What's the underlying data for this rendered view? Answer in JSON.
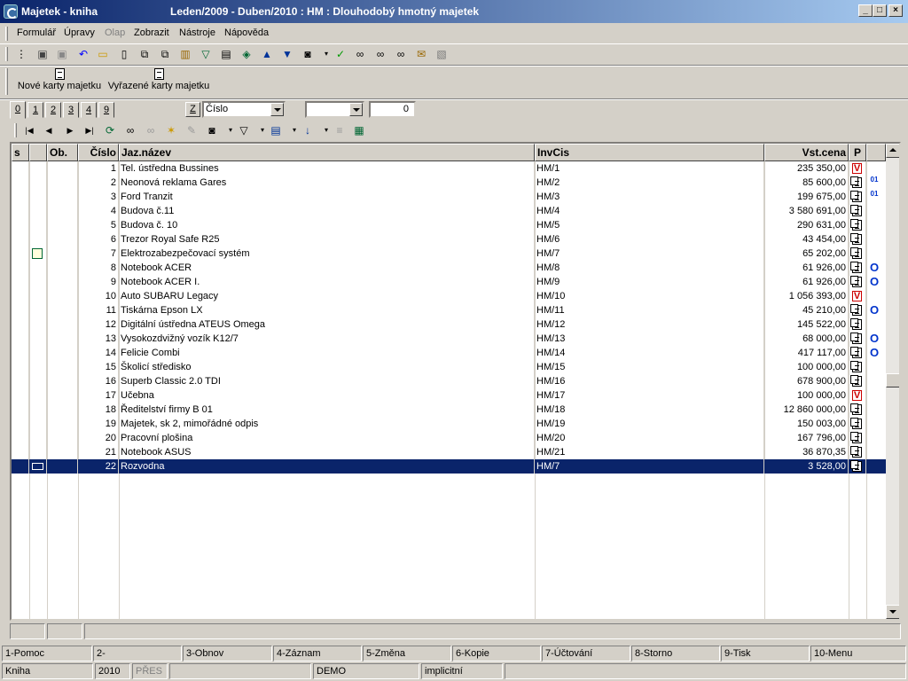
{
  "window": {
    "title_left": "Majetek - kniha",
    "title_center": "Leden/2009 - Duben/2010 : HM : Dlouhodobý hmotný majetek",
    "min_label": "_",
    "max_label": "□",
    "close_label": "×"
  },
  "menu": {
    "items": [
      "Formulář",
      "Úpravy",
      "Olap",
      "Zobrazit",
      "Nástroje",
      "Nápověda"
    ]
  },
  "big_toolbar": {
    "new_cards": "Nové karty majetku",
    "discarded_cards": "Vyřazené karty majetku"
  },
  "tabs": [
    "0",
    "1",
    "2",
    "3",
    "4",
    "9"
  ],
  "filter": {
    "z_label": "Z",
    "sort_field": "Číslo",
    "second_combo": "",
    "number_value": "0"
  },
  "grid": {
    "headers": {
      "s": "s",
      "blank": "",
      "ob": "Ob.",
      "cislo": "Číslo",
      "nazev": "Jaz.název",
      "invcis": "InvCis",
      "cena": "Vst.cena",
      "p": "P"
    },
    "rows": [
      {
        "cislo": "1",
        "nazev": "Tel. ústředna Bussines",
        "inv": "HM/1",
        "cena": "235 350,00",
        "p": "V",
        "extra": ""
      },
      {
        "cislo": "2",
        "nazev": "Neonová reklama Gares",
        "inv": "HM/2",
        "cena": "85 600,00",
        "p": "doc",
        "extra": "01"
      },
      {
        "cislo": "3",
        "nazev": "Ford Tranzit",
        "inv": "HM/3",
        "cena": "199 675,00",
        "p": "doc",
        "extra": "01"
      },
      {
        "cislo": "4",
        "nazev": "Budova  č.11",
        "inv": "HM/4",
        "cena": "3 580 691,00",
        "p": "doc",
        "extra": ""
      },
      {
        "cislo": "5",
        "nazev": "Budova č. 10",
        "inv": "HM/5",
        "cena": "290 631,00",
        "p": "doc",
        "extra": ""
      },
      {
        "cislo": "6",
        "nazev": "Trezor Royal Safe R25",
        "inv": "HM/6",
        "cena": "43 454,00",
        "p": "doc",
        "extra": ""
      },
      {
        "cislo": "7",
        "nazev": "Elektrozabezpečovací systém",
        "inv": "HM/7",
        "cena": "65 202,00",
        "p": "doc",
        "extra": ""
      },
      {
        "cislo": "8",
        "nazev": "Notebook ACER",
        "inv": "HM/8",
        "cena": "61 926,00",
        "p": "doc",
        "extra": "O"
      },
      {
        "cislo": "9",
        "nazev": "Notebook ACER I.",
        "inv": "HM/9",
        "cena": "61 926,00",
        "p": "doc",
        "extra": "O"
      },
      {
        "cislo": "10",
        "nazev": "Auto SUBARU Legacy",
        "inv": "HM/10",
        "cena": "1 056 393,00",
        "p": "V",
        "extra": ""
      },
      {
        "cislo": "11",
        "nazev": "Tiskárna Epson LX",
        "inv": "HM/11",
        "cena": "45 210,00",
        "p": "doc",
        "extra": "O"
      },
      {
        "cislo": "12",
        "nazev": "Digitální ústředna ATEUS Omega",
        "inv": "HM/12",
        "cena": "145 522,00",
        "p": "doc",
        "extra": ""
      },
      {
        "cislo": "13",
        "nazev": "Vysokozdvižný vozík K12/7",
        "inv": "HM/13",
        "cena": "68 000,00",
        "p": "doc",
        "extra": "O"
      },
      {
        "cislo": "14",
        "nazev": "Felicie Combi",
        "inv": "HM/14",
        "cena": "417 117,00",
        "p": "doc",
        "extra": "O"
      },
      {
        "cislo": "15",
        "nazev": "Školicí středisko",
        "inv": "HM/15",
        "cena": "100 000,00",
        "p": "doc",
        "extra": ""
      },
      {
        "cislo": "16",
        "nazev": "Superb Classic  2.0 TDI",
        "inv": "HM/16",
        "cena": "678 900,00",
        "p": "doc",
        "extra": ""
      },
      {
        "cislo": "17",
        "nazev": "Učebna",
        "inv": "HM/17",
        "cena": "100 000,00",
        "p": "V",
        "extra": ""
      },
      {
        "cislo": "18",
        "nazev": "Ředitelství firmy B 01",
        "inv": "HM/18",
        "cena": "12 860 000,00",
        "p": "doc",
        "extra": ""
      },
      {
        "cislo": "19",
        "nazev": "Majetek, sk 2, mimořádné odpis",
        "inv": "HM/19",
        "cena": "150 003,00",
        "p": "doc",
        "extra": ""
      },
      {
        "cislo": "20",
        "nazev": "Pracovní plošina",
        "inv": "HM/20",
        "cena": "167 796,00",
        "p": "doc",
        "extra": ""
      },
      {
        "cislo": "21",
        "nazev": "Notebook ASUS",
        "inv": "HM/21",
        "cena": "36 870,35",
        "p": "doc",
        "extra": ""
      },
      {
        "cislo": "22",
        "nazev": "Rozvodna",
        "inv": "HM/7",
        "cena": "3 528,00",
        "p": "doc",
        "extra": ""
      }
    ],
    "selected_row": 21
  },
  "fkeys": [
    "1-Pomoc",
    "2-",
    "3-Obnov",
    "4-Záznam",
    "5-Změna",
    "6-Kopie",
    "7-Účtování",
    "8-Storno",
    "9-Tisk",
    "10-Menu"
  ],
  "statusbar": {
    "module": "Kniha",
    "year": "2010",
    "mode": "PŘES",
    "empty1": "",
    "company": "DEMO",
    "config": "implicitní"
  },
  "colors": {
    "title_start": "#0a246a",
    "title_end": "#a6caf0",
    "selection": "#0a246a",
    "face": "#d4d0c8",
    "p_red": "#cc0000",
    "extra_blue": "#0033cc"
  }
}
